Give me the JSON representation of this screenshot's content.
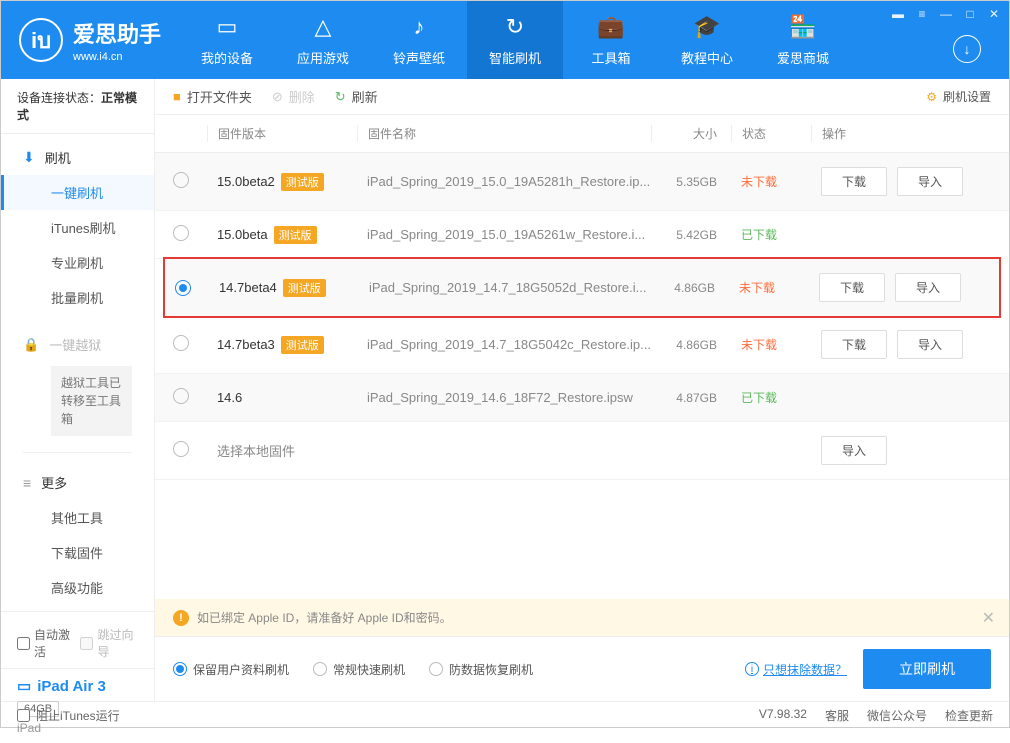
{
  "header": {
    "app_name": "爱思助手",
    "app_url": "www.i4.cn",
    "nav": [
      {
        "label": "我的设备"
      },
      {
        "label": "应用游戏"
      },
      {
        "label": "铃声壁纸"
      },
      {
        "label": "智能刷机"
      },
      {
        "label": "工具箱"
      },
      {
        "label": "教程中心"
      },
      {
        "label": "爱思商城"
      }
    ]
  },
  "sidebar": {
    "conn_label": "设备连接状态：",
    "conn_value": "正常模式",
    "group_flash": {
      "title": "刷机",
      "items": [
        {
          "label": "一键刷机"
        },
        {
          "label": "iTunes刷机"
        },
        {
          "label": "专业刷机"
        },
        {
          "label": "批量刷机"
        }
      ]
    },
    "group_jailbreak": {
      "title": "一键越狱",
      "note": "越狱工具已转移至工具箱"
    },
    "group_more": {
      "title": "更多",
      "items": [
        {
          "label": "其他工具"
        },
        {
          "label": "下载固件"
        },
        {
          "label": "高级功能"
        }
      ]
    },
    "auto_activate": "自动激活",
    "skip_guide": "跳过向导",
    "device": {
      "name": "iPad Air 3",
      "storage": "64GB",
      "type": "iPad"
    }
  },
  "toolbar": {
    "open_folder": "打开文件夹",
    "delete": "删除",
    "refresh": "刷新",
    "settings": "刷机设置"
  },
  "table": {
    "headers": {
      "version": "固件版本",
      "name": "固件名称",
      "size": "大小",
      "status": "状态",
      "ops": "操作"
    },
    "beta_tag": "测试版",
    "btn_download": "下载",
    "btn_import": "导入",
    "status_notdl": "未下载",
    "status_dl": "已下载",
    "rows": [
      {
        "version": "15.0beta2",
        "beta": true,
        "name": "iPad_Spring_2019_15.0_19A5281h_Restore.ip...",
        "size": "5.35GB",
        "downloaded": false,
        "ops": true,
        "selected": false
      },
      {
        "version": "15.0beta",
        "beta": true,
        "name": "iPad_Spring_2019_15.0_19A5261w_Restore.i...",
        "size": "5.42GB",
        "downloaded": true,
        "ops": false,
        "selected": false
      },
      {
        "version": "14.7beta4",
        "beta": true,
        "name": "iPad_Spring_2019_14.7_18G5052d_Restore.i...",
        "size": "4.86GB",
        "downloaded": false,
        "ops": true,
        "selected": true,
        "highlight": true
      },
      {
        "version": "14.7beta3",
        "beta": true,
        "name": "iPad_Spring_2019_14.7_18G5042c_Restore.ip...",
        "size": "4.86GB",
        "downloaded": false,
        "ops": true,
        "selected": false
      },
      {
        "version": "14.6",
        "beta": false,
        "name": "iPad_Spring_2019_14.6_18F72_Restore.ipsw",
        "size": "4.87GB",
        "downloaded": true,
        "ops": false,
        "selected": false
      }
    ],
    "local_row_label": "选择本地固件"
  },
  "warning": {
    "text": "如已绑定 Apple ID，请准备好 Apple ID和密码。"
  },
  "options": {
    "keep_data": "保留用户资料刷机",
    "normal_fast": "常规快速刷机",
    "anti_loss": "防数据恢复刷机",
    "only_erase_link": "只想抹除数据？",
    "flash_now": "立即刷机"
  },
  "footer": {
    "block_itunes": "阻止iTunes运行",
    "version": "V7.98.32",
    "service": "客服",
    "wechat": "微信公众号",
    "check_update": "检查更新"
  }
}
